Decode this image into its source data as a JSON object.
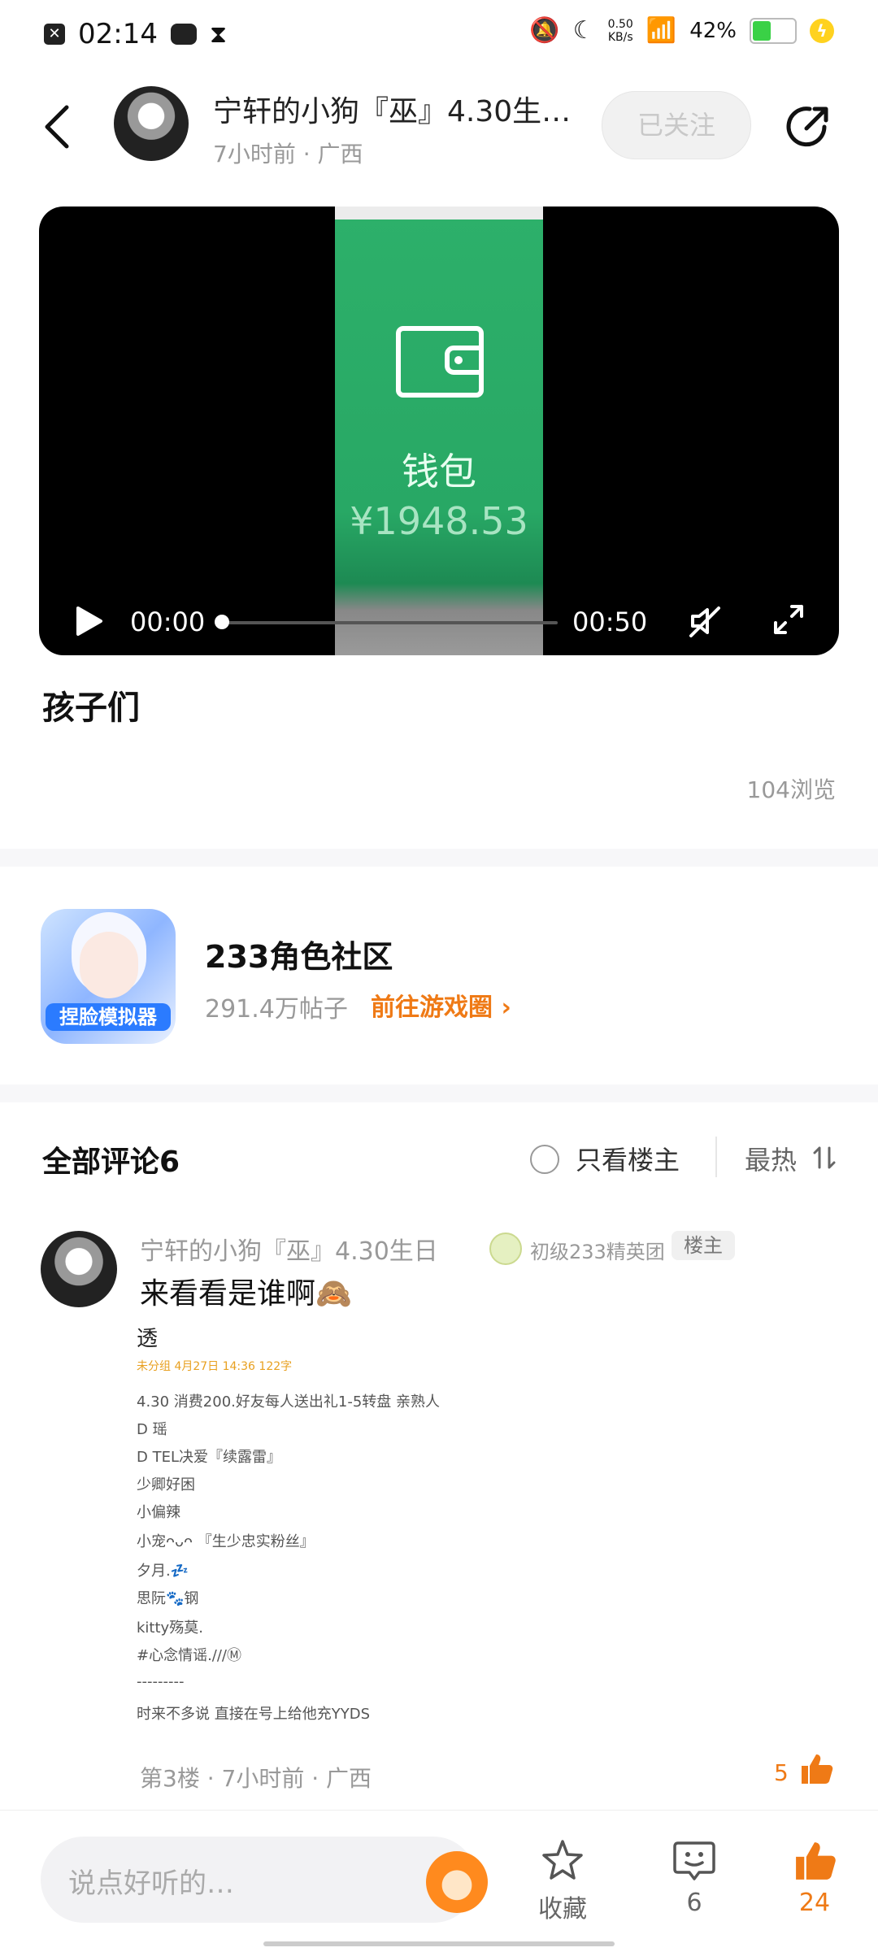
{
  "status_bar": {
    "time": "02:14",
    "net_speed_value": "0.50",
    "net_speed_unit": "KB/s",
    "battery": "42%"
  },
  "header": {
    "author": "宁轩的小狗『巫』4.30生…",
    "meta": "7小时前 · 广西",
    "follow_label": "已关注"
  },
  "video": {
    "wallet_label": "钱包",
    "wallet_amount": "¥1948.53",
    "current_time": "00:00",
    "duration": "00:50",
    "progress": 0
  },
  "post": {
    "text": "孩子们",
    "views": "104浏览"
  },
  "community": {
    "icon_text": "捏脸模拟器",
    "name": "233角色社区",
    "posts": "291.4万帖子",
    "link": "前往游戏圈"
  },
  "comments": {
    "title": "全部评论6",
    "only_owner": "只看楼主",
    "sort": "最热",
    "item": {
      "user": "宁轩的小狗『巫』4.30生日",
      "level": "初级233精英团",
      "owner_badge": "楼主",
      "text": "来看看是谁啊🙈",
      "image_lines": [
        "透",
        "未分组  4月27日 14:36  122字",
        "4.30 消费200.好友每人送出礼1-5转盘 亲熟人",
        "D 瑶",
        "D TEL决爱『续露雷』",
        "少卿好困",
        "小偏辣",
        "小宠ᴖᴗᴖ 『生少忠实粉丝』",
        "夕月.💤",
        "思阮🐾钢",
        "kitty殇莫.",
        "#心念情谣.///Ⓜ",
        "---------",
        "时来不多说 直接在号上给他充YYDS"
      ],
      "meta": "第3楼 · 7小时前 · 广西",
      "likes": "5"
    }
  },
  "bottom_bar": {
    "placeholder": "说点好听的…",
    "collect": "收藏",
    "comments_count": "6",
    "likes_count": "24"
  }
}
